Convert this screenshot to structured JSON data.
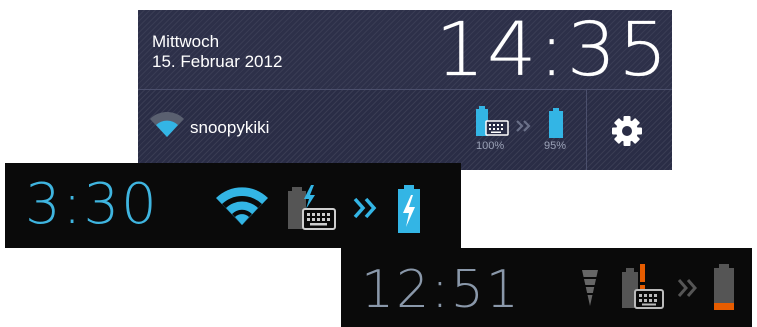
{
  "notification_panel": {
    "day": "Mittwoch",
    "date": "15. Februar 2012",
    "time": "14:35",
    "wifi_ssid": "snoopykiki",
    "keyboard_battery_percent": "100%",
    "tablet_battery_percent": "95%",
    "icons": [
      "wifi-icon",
      "keyboard-battery-icon",
      "chevron-double-icon",
      "battery-icon",
      "gear-icon"
    ]
  },
  "status_bar_charging": {
    "time": "3:30",
    "icons": [
      "wifi-icon",
      "keyboard-charging-icon",
      "chevron-double-icon",
      "battery-charging-icon"
    ],
    "accent_color": "#3fb5e0"
  },
  "status_bar_low": {
    "time": "12:51",
    "icons": [
      "signal-icon",
      "keyboard-warning-icon",
      "chevron-double-icon",
      "battery-low-icon"
    ],
    "warning_color": "#e65c00"
  }
}
